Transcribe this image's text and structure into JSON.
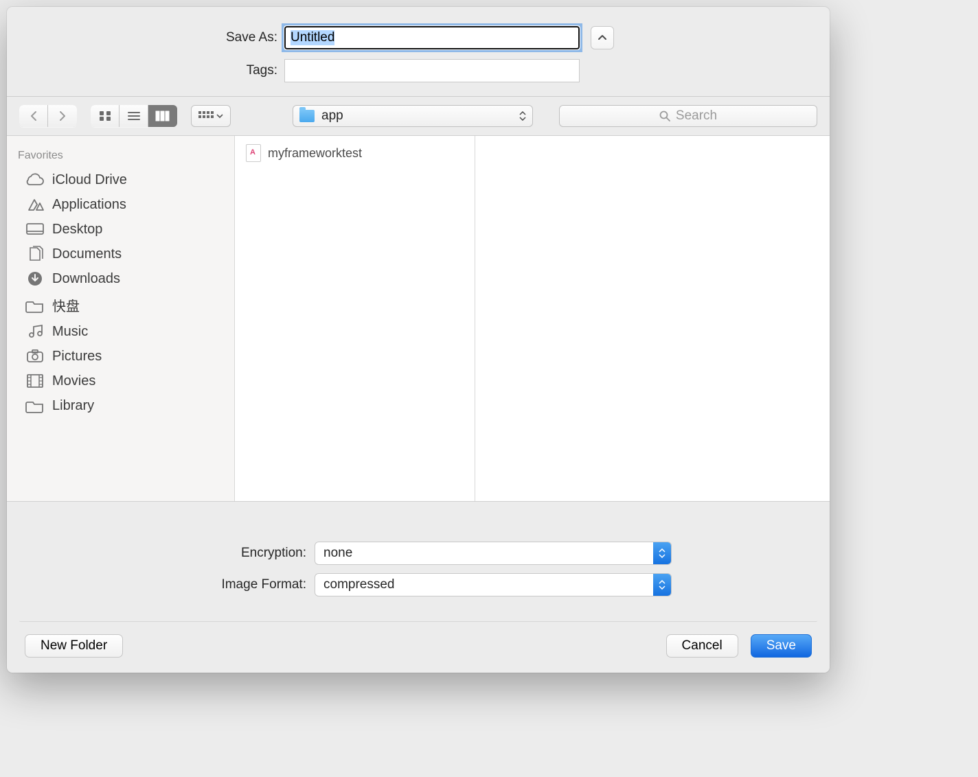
{
  "form": {
    "save_as_label": "Save As:",
    "save_as_value": "Untitled",
    "tags_label": "Tags:",
    "tags_value": ""
  },
  "toolbar": {
    "location": "app",
    "search_placeholder": "Search"
  },
  "sidebar": {
    "header": "Favorites",
    "items": [
      {
        "icon": "cloud",
        "label": "iCloud Drive"
      },
      {
        "icon": "apps",
        "label": "Applications"
      },
      {
        "icon": "desktop",
        "label": "Desktop"
      },
      {
        "icon": "documents",
        "label": "Documents"
      },
      {
        "icon": "downloads",
        "label": "Downloads"
      },
      {
        "icon": "folder",
        "label": "快盘"
      },
      {
        "icon": "music",
        "label": "Music"
      },
      {
        "icon": "pictures",
        "label": "Pictures"
      },
      {
        "icon": "movies",
        "label": "Movies"
      },
      {
        "icon": "folder",
        "label": "Library"
      }
    ]
  },
  "column1": {
    "items": [
      {
        "label": "myframeworktest"
      }
    ]
  },
  "options": {
    "encryption_label": "Encryption:",
    "encryption_value": "none",
    "format_label": "Image Format:",
    "format_value": "compressed"
  },
  "footer": {
    "new_folder": "New Folder",
    "cancel": "Cancel",
    "save": "Save"
  }
}
